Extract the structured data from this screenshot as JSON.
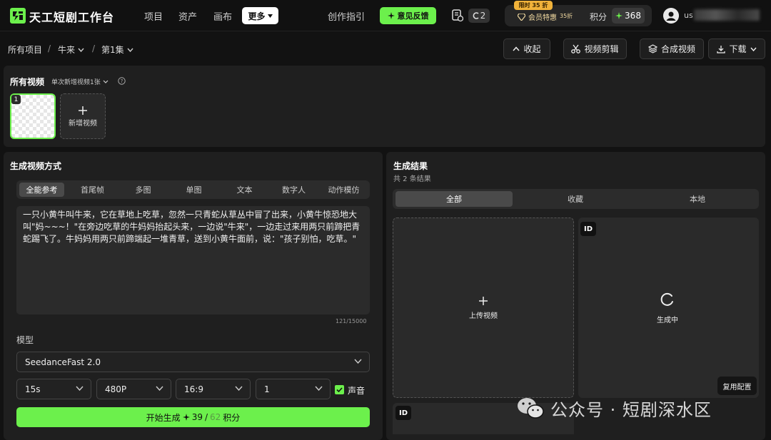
{
  "brand": {
    "name": "天工短剧工作台"
  },
  "nav": {
    "items": [
      "项目",
      "资产",
      "画布"
    ],
    "more": "更多",
    "guide": "创作指引",
    "feedback": "意见反馈"
  },
  "credits": {
    "count": "2"
  },
  "vip": {
    "promo": "限时 35 折",
    "label": "会员特惠",
    "discount": "35折"
  },
  "points": {
    "label": "积分",
    "value": "368"
  },
  "user": {
    "name": "us"
  },
  "breadcrumb": {
    "root": "所有项目",
    "project": "牛来",
    "episode": "第1集"
  },
  "toolbar": {
    "collapse": "收起",
    "video_edit": "视频剪辑",
    "compose": "合成视频",
    "download": "下载"
  },
  "videos": {
    "title": "所有视频",
    "batch": "单次新增视频1张",
    "thumb_index": "1",
    "add_label": "新增视频"
  },
  "generate": {
    "title": "生成视频方式",
    "tabs": [
      "全能参考",
      "首尾帧",
      "多图",
      "单图",
      "文本",
      "数字人",
      "动作模仿"
    ],
    "active_tab": 0,
    "prompt": "一只小黄牛叫牛来，它在草地上吃草，忽然一只青蛇从草丛中冒了出来，小黄牛惊恐地大叫\"妈~~~！\"在旁边吃草的牛妈妈抬起头来，一边说\"牛来\"，一边走过来用两只前蹄把青蛇踢飞了。牛妈妈用两只前蹄端起一堆青草，送到小黄牛面前，说：\"孩子别怕，吃草。\"",
    "counter": "121/15000",
    "model_label": "模型",
    "model": "SeedanceFast 2.0",
    "duration": "15s",
    "resolution": "480P",
    "ratio": "16:9",
    "count": "1",
    "sound_label": "声音",
    "sound_checked": true,
    "button_prefix": "开始生成",
    "button_cost": "39",
    "button_sep": "/",
    "button_old": "62",
    "button_suffix": "积分"
  },
  "results": {
    "title": "生成结果",
    "count_text": "共 2 条结果",
    "tabs": [
      "全部",
      "收藏",
      "本地"
    ],
    "active_tab": 0,
    "upload_label": "上传视频",
    "id_badge": "ID",
    "generating_label": "生成中",
    "reuse_label": "复用配置"
  },
  "watermark": {
    "text": "公众号 · 短剧深水区"
  },
  "colors": {
    "accent": "#6cf04c",
    "panel": "#1f1f1f",
    "background": "#121212",
    "promo": "#f0b23a"
  },
  "icons": [
    "logo-icon",
    "chevron-down-icon",
    "sparkle-icon",
    "file-icon",
    "diamond-icon",
    "user-icon",
    "chevron-up-icon",
    "scissors-icon",
    "layers-icon",
    "download-icon",
    "help-icon",
    "plus-icon",
    "check-icon",
    "spinner-icon",
    "wechat-icon"
  ]
}
